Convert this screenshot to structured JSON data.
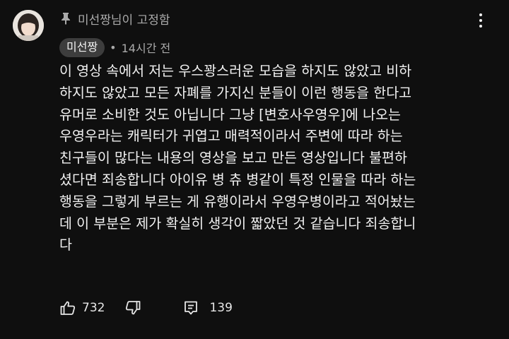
{
  "comment": {
    "pinned_label": "미선짱님이 고정함",
    "author": "미선짱",
    "time": "14시간 전",
    "separator": "•",
    "lines": [
      "이 영상 속에서 저는 우스꽝스러운 모습을 하지도 않았고 비하",
      "하지도 않았고 모든 자폐를 가지신 분들이 이런 행동을 한다고",
      "유머로 소비한 것도 아닙니다 그냥 [변호사우영우]에 나오는",
      "우영우라는 캐릭터가 귀엽고 매력적이라서 주변에 따라 하는",
      "친구들이 많다는 내용의 영상을 보고 만든 영상입니다 불편하",
      "셨다면 죄송합니다 아이유 병 츄 병같이 특정 인물을 따라 하는",
      "행동을 그렇게 부르는 게 유행이라서 우영우병이라고 적어놨는",
      "데 이 부분은 제가 확실히 생각이 짧았던 것 같습니다 죄송합니",
      "다"
    ],
    "likes": "732",
    "replies": "139"
  },
  "icons": {
    "pin": "pin-icon",
    "more": "more-vertical-icon",
    "like": "thumbs-up-icon",
    "dislike": "thumbs-down-icon",
    "reply": "reply-comment-icon"
  },
  "colors": {
    "background": "#0f0f0f",
    "text": "#f1f1f1",
    "secondary": "#aaaaaa",
    "badge": "#3d3d3d"
  }
}
